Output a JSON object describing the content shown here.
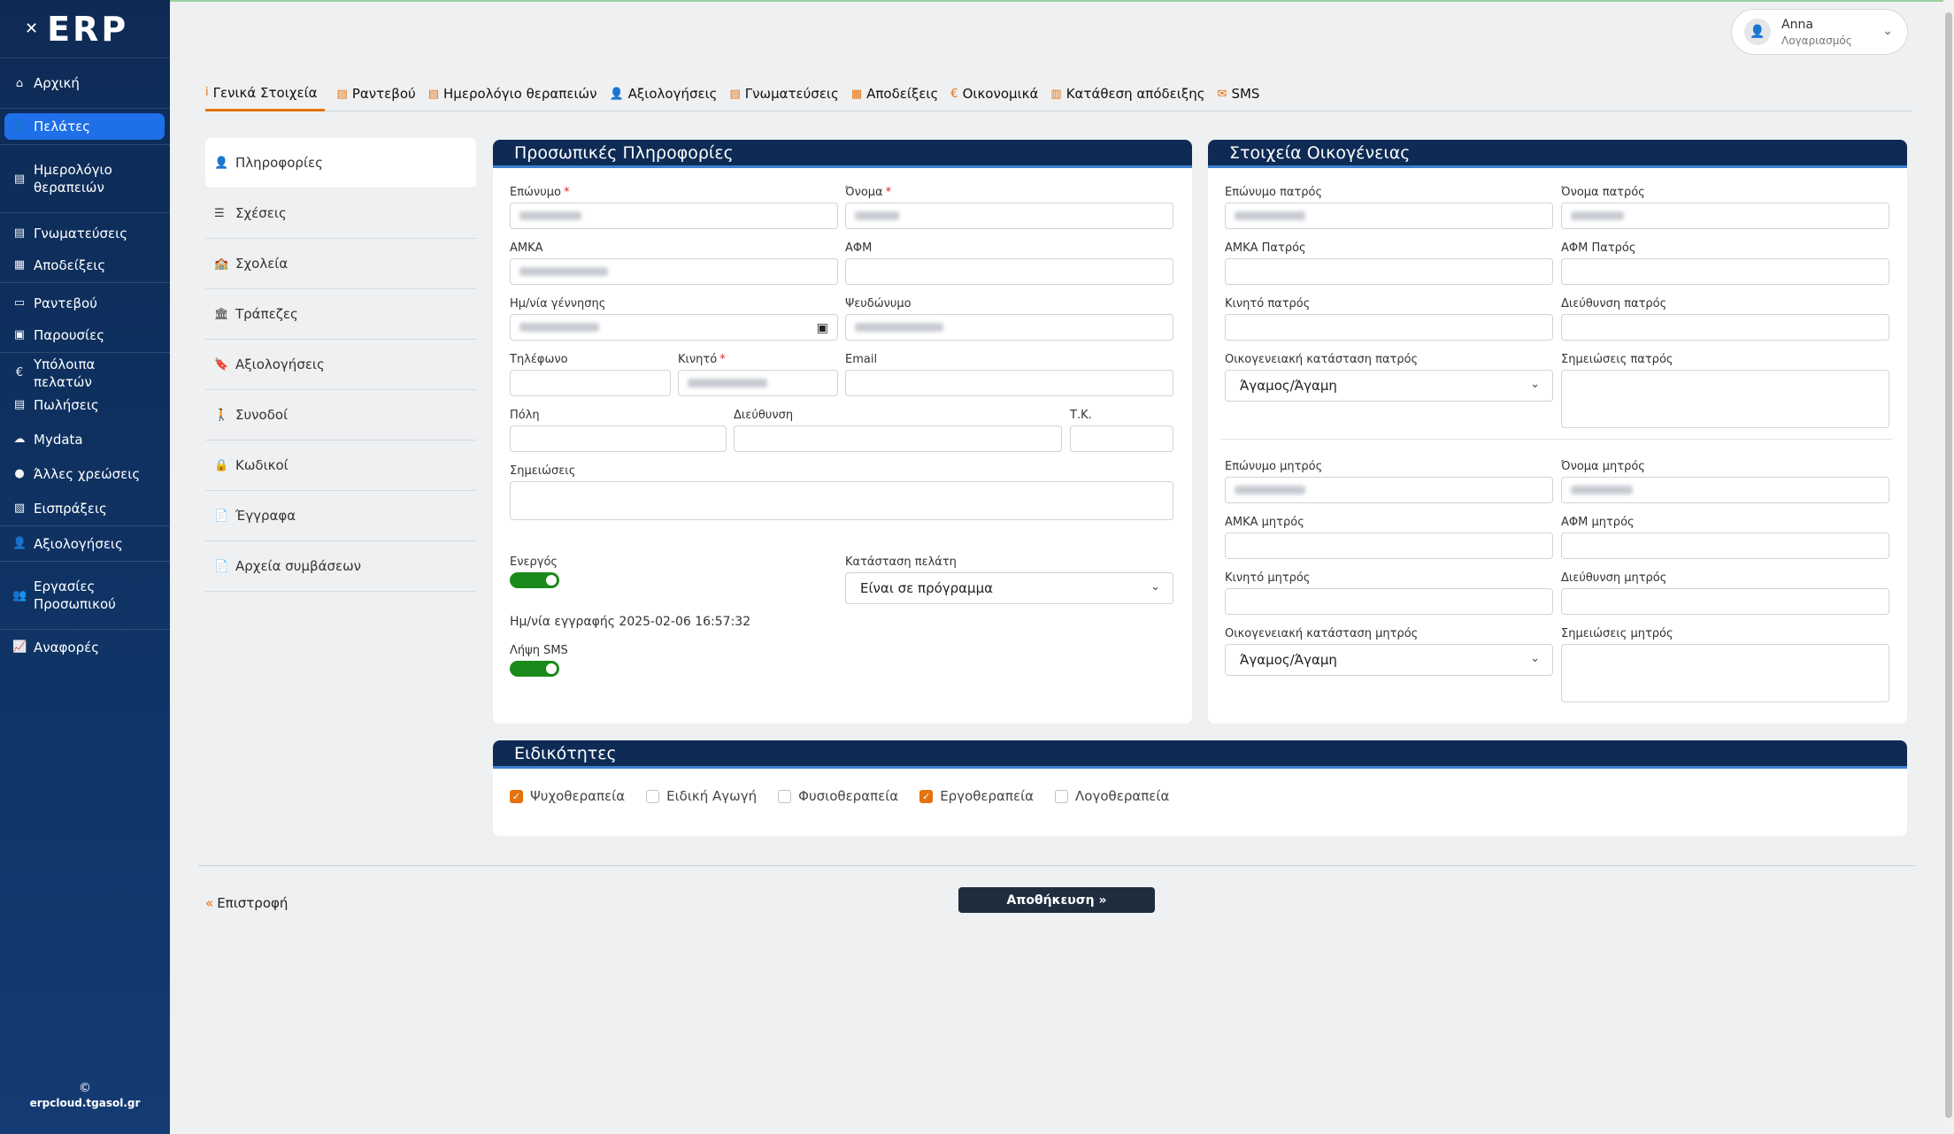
{
  "brand": {
    "logo_text": "ERP",
    "logo_mark": "✕"
  },
  "sidebar": {
    "items": [
      {
        "label": "Αρχική",
        "icon": "home-icon",
        "glyph": "⌂"
      },
      {
        "label": "Πελάτες",
        "icon": "user-icon",
        "glyph": "👤",
        "active": true
      },
      {
        "label": "Ημερολόγιο\nθεραπειών",
        "icon": "calendar-book-icon",
        "glyph": "▤"
      },
      {
        "label": "Γνωματεύσεις",
        "icon": "document-icon",
        "glyph": "▤"
      },
      {
        "label": "Αποδείξεις",
        "icon": "receipt-icon",
        "glyph": "▦"
      },
      {
        "label": "Ραντεβού",
        "icon": "calendar-icon",
        "glyph": "▭"
      },
      {
        "label": "Παρουσίες",
        "icon": "attendance-icon",
        "glyph": "▣"
      },
      {
        "label": "Υπόλοιπα πελατών",
        "icon": "euro-icon",
        "glyph": "€"
      },
      {
        "label": "Πωλήσεις",
        "icon": "sales-icon",
        "glyph": "▤"
      },
      {
        "label": "Mydata",
        "icon": "cloud-icon",
        "glyph": "☁"
      },
      {
        "label": "Άλλες χρεώσεις",
        "icon": "coins-icon",
        "glyph": "●"
      },
      {
        "label": "Εισπράξεις",
        "icon": "cash-icon",
        "glyph": "▧"
      },
      {
        "label": "Αξιολογήσεις",
        "icon": "user-check-icon",
        "glyph": "👤"
      },
      {
        "label": "Εργασίες\nΠροσωπικού",
        "icon": "staff-icon",
        "glyph": "👥"
      },
      {
        "label": "Αναφορές",
        "icon": "chart-icon",
        "glyph": "📈"
      }
    ],
    "footer_copy": "©",
    "footer_site": "erpcloud.tgasol.gr"
  },
  "account": {
    "name": "Anna",
    "sub": "Λογαριασμός"
  },
  "tabs": [
    {
      "label": "Γενικά Στοιχεία",
      "glyph": "i",
      "icon": "info-icon"
    },
    {
      "label": "Ραντεβού",
      "glyph": "▤",
      "icon": "calendar-list-icon"
    },
    {
      "label": "Ημερολόγιο θεραπειών",
      "glyph": "▤",
      "icon": "calendar-book-icon"
    },
    {
      "label": "Αξιολογήσεις",
      "glyph": "👤",
      "icon": "user-check-icon"
    },
    {
      "label": "Γνωματεύσεις",
      "glyph": "▤",
      "icon": "document-icon"
    },
    {
      "label": "Αποδείξεις",
      "glyph": "▦",
      "icon": "receipt-icon"
    },
    {
      "label": "Οικονομικά",
      "glyph": "€",
      "icon": "euro-icon"
    },
    {
      "label": "Κατάθεση απόδειξης",
      "glyph": "▥",
      "icon": "receipt-upload-icon"
    },
    {
      "label": "SMS",
      "glyph": "✉",
      "icon": "envelope-icon"
    }
  ],
  "submenu": [
    {
      "label": "Πληροφορίες",
      "glyph": "👤",
      "icon": "user-icon"
    },
    {
      "label": "Σχέσεις",
      "glyph": "☰",
      "icon": "relations-icon"
    },
    {
      "label": "Σχολεία",
      "glyph": "🏫",
      "icon": "school-icon"
    },
    {
      "label": "Τράπεζες",
      "glyph": "🏛",
      "icon": "bank-icon"
    },
    {
      "label": "Αξιολογήσεις",
      "glyph": "🔖",
      "icon": "bookmark-icon"
    },
    {
      "label": "Συνοδοί",
      "glyph": "🚶",
      "icon": "walking-icon"
    },
    {
      "label": "Κωδικοί",
      "glyph": "🔒",
      "icon": "lock-icon"
    },
    {
      "label": "Έγγραφα",
      "glyph": "📄",
      "icon": "file-icon"
    },
    {
      "label": "Αρχεία συμβάσεων",
      "glyph": "📄",
      "icon": "contract-file-icon"
    }
  ],
  "personal": {
    "title": "Προσωπικές Πληροφορίες",
    "surname_label": "Επώνυμο",
    "name_label": "Όνομα",
    "amka_label": "ΑΜΚΑ",
    "afm_label": "ΑΦΜ",
    "birth_label": "Ημ/νία γέννησης",
    "nickname_label": "Ψευδώνυμο",
    "phone_label": "Τηλέφωνο",
    "mobile_label": "Κινητό",
    "email_label": "Email",
    "city_label": "Πόλη",
    "address_label": "Διεύθυνση",
    "zip_label": "Τ.Κ.",
    "notes_label": "Σημειώσεις",
    "active_label": "Ενεργός",
    "status_label": "Κατάσταση πελάτη",
    "status_value": "Είναι σε πρόγραμμα",
    "registered": "Ημ/νία εγγραφής 2025-02-06 16:57:32",
    "sms_label": "Λήψη SMS",
    "required_mark": "*"
  },
  "family": {
    "title": "Στοιχεία Οικογένειας",
    "f_surname": "Επώνυμο πατρός",
    "f_name": "Όνομα πατρός",
    "f_amka": "ΑΜΚΑ Πατρός",
    "f_afm": "ΑΦΜ Πατρός",
    "f_mobile": "Κινητό πατρός",
    "f_address": "Διεύθυνση πατρός",
    "f_marital": "Οικογενειακή κατάσταση πατρός",
    "f_notes": "Σημειώσεις πατρός",
    "f_marital_value": "Άγαμος/Άγαμη",
    "m_surname": "Επώνυμο μητρός",
    "m_name": "Όνομα μητρός",
    "m_amka": "ΑΜΚΑ μητρός",
    "m_afm": "ΑΦΜ μητρός",
    "m_mobile": "Κινητό μητρός",
    "m_address": "Διεύθυνση μητρός",
    "m_marital": "Οικογενειακή κατάσταση μητρός",
    "m_notes": "Σημειώσεις μητρός",
    "m_marital_value": "Άγαμος/Άγαμη"
  },
  "specialties": {
    "title": "Ειδικότητες",
    "items": [
      {
        "label": "Ψυχοθεραπεία",
        "checked": true
      },
      {
        "label": "Ειδική Αγωγή",
        "checked": false
      },
      {
        "label": "Φυσιοθεραπεία",
        "checked": false
      },
      {
        "label": "Εργοθεραπεία",
        "checked": true
      },
      {
        "label": "Λογοθεραπεία",
        "checked": false
      }
    ]
  },
  "footer": {
    "back": "Επιστροφή",
    "back_arrow": "«",
    "save": "Αποθήκευση »"
  },
  "colors": {
    "accent": "#e5720c",
    "sidebar": "#0e2b55",
    "active": "#1e6fe8",
    "toggle": "#1a8a1a"
  }
}
